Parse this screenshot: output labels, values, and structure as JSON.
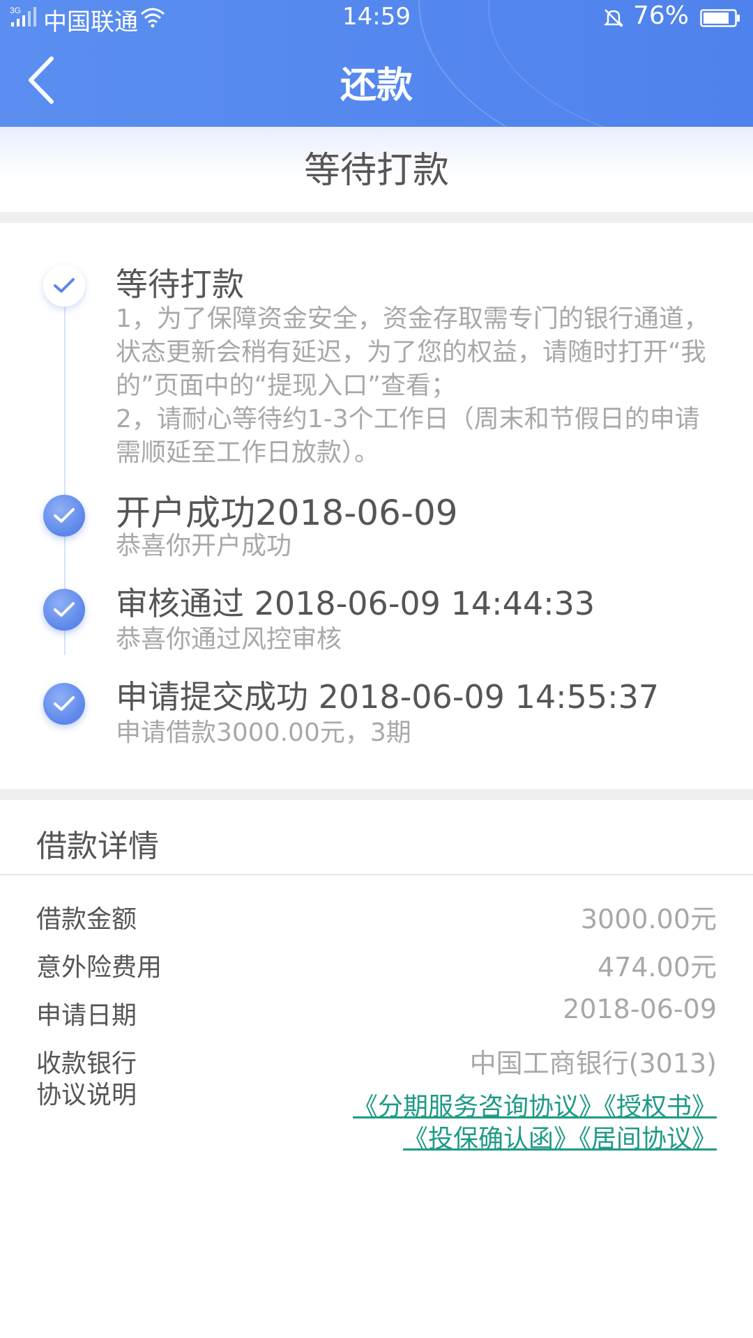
{
  "status_bar": {
    "network": "3G",
    "carrier": "中国联通",
    "time": "14:59",
    "battery": "76%"
  },
  "nav": {
    "title": "还款"
  },
  "status_banner": {
    "title": "等待打款"
  },
  "timeline": [
    {
      "title": "等待打款",
      "state": "pending",
      "description": [
        "1，为了保障资金安全，资金存取需专门的银行通道，状态更新会稍有延迟，为了您的权益，请随时打开“我的”页面中的“提现入口”查看；",
        "2，请耐心等待约1-3个工作日（周末和节假日的申请需顺延至工作日放款）。"
      ]
    },
    {
      "title": "开户成功2018-06-09",
      "state": "done",
      "description": [
        "恭喜你开户成功"
      ]
    },
    {
      "title": "审核通过  2018-06-09 14:44:33",
      "state": "done",
      "description": [
        "恭喜你通过风控审核"
      ]
    },
    {
      "title": "申请提交成功  2018-06-09 14:55:37",
      "state": "done",
      "description": [
        "申请借款3000.00元，3期"
      ]
    }
  ],
  "details": {
    "title": "借款详情",
    "rows": [
      {
        "label": "借款金额",
        "value": "3000.00元"
      },
      {
        "label": "意外险费用",
        "value": "474.00元"
      },
      {
        "label": "申请日期",
        "value": "2018-06-09"
      },
      {
        "label": "收款银行",
        "value": "中国工商银行(3013)"
      }
    ],
    "agreement_label": "协议说明",
    "agreements": [
      "《分期服务咨询协议》",
      "《授权书》",
      "《投保确认函》",
      "《居间协议》"
    ]
  },
  "colors": {
    "header_blue": "#5b8ef0",
    "timeline_dot": "#5b86ea",
    "link_green": "#1e9a86"
  }
}
